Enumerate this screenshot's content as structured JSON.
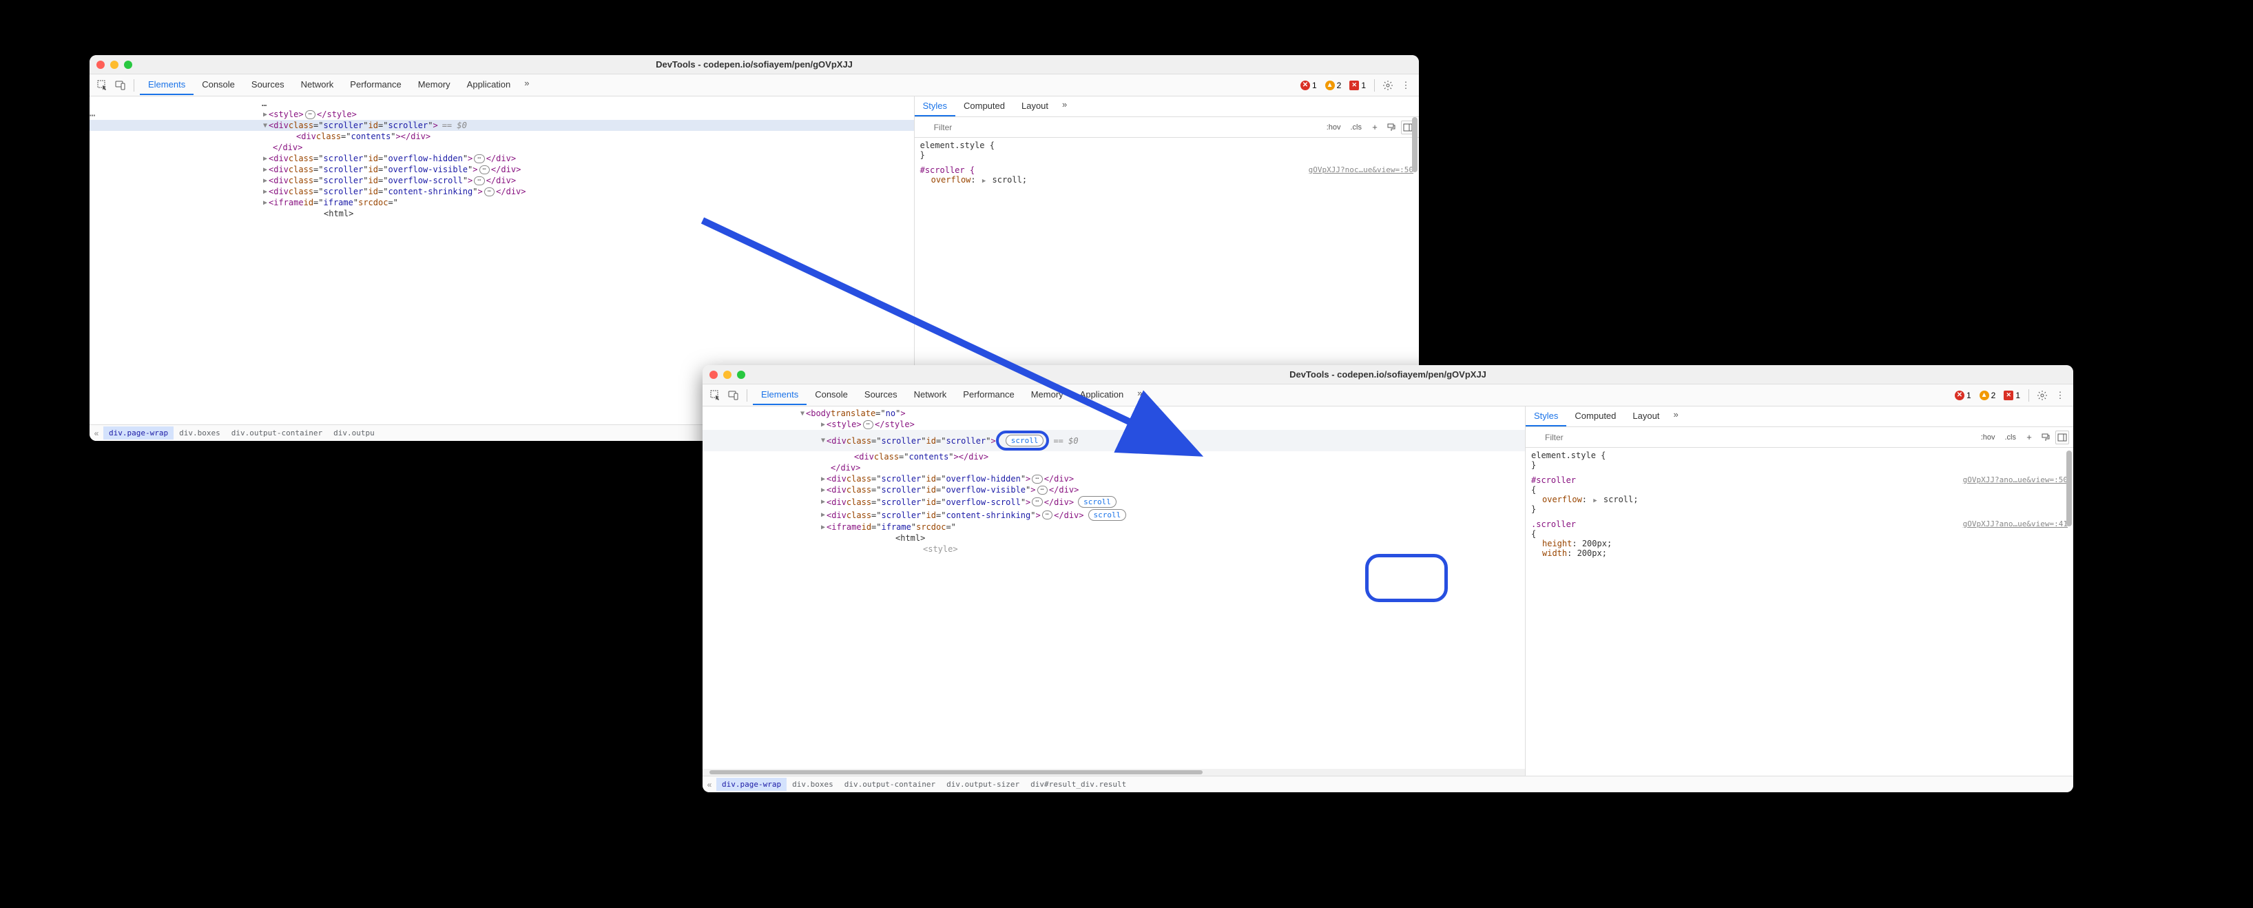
{
  "window1": {
    "title": "DevTools - codepen.io/sofiayem/pen/gOVpXJJ",
    "tabs": [
      "Elements",
      "Console",
      "Sources",
      "Network",
      "Performance",
      "Memory",
      "Application"
    ],
    "activeTab": "Elements",
    "issues": {
      "errors": "1",
      "warnings": "2",
      "info": "1"
    },
    "dom": {
      "line_body_truncated": "…",
      "style_open": "<style>",
      "style_close": "</style>",
      "scroller_open_tag": "div",
      "scroller_class": "scroller",
      "scroller_id": "scroller",
      "sel_marker": "== $0",
      "contents_tag": "div",
      "contents_class": "contents",
      "close_div": "</div>",
      "rows": [
        {
          "id": "overflow-hidden"
        },
        {
          "id": "overflow-visible"
        },
        {
          "id": "overflow-scroll"
        },
        {
          "id": "content-shrinking"
        }
      ],
      "iframe_tag": "iframe",
      "iframe_id": "iframe",
      "iframe_srcdoc": "srcdoc",
      "html_inner": "<html>"
    },
    "side": {
      "tabs": [
        "Styles",
        "Computed",
        "Layout"
      ],
      "activeTab": "Styles",
      "filter_placeholder": "Filter",
      "hov": ":hov",
      "cls": ".cls",
      "rules": {
        "element_style": "element.style {",
        "close_brace": "}",
        "scroller_sel": "#scroller {",
        "scroller_src": "gOVpXJJ?noc…ue&view=:50",
        "overflow_prop": "overflow",
        "overflow_val": "scroll"
      }
    },
    "breadcrumbs": [
      "div.page-wrap",
      "div.boxes",
      "div.output-container",
      "div.outpu"
    ]
  },
  "window2": {
    "title": "DevTools - codepen.io/sofiayem/pen/gOVpXJJ",
    "tabs": [
      "Elements",
      "Console",
      "Sources",
      "Network",
      "Performance",
      "Memory",
      "Application"
    ],
    "activeTab": "Elements",
    "issues": {
      "errors": "1",
      "warnings": "2",
      "info": "1"
    },
    "dom": {
      "body_translate": "no",
      "style_open": "<style>",
      "style_close": "</style>",
      "scroller_tag": "div",
      "scroller_class": "scroller",
      "scroller_id": "scroller",
      "scroll_badge": "scroll",
      "sel_marker": "== $0",
      "contents_tag": "div",
      "contents_class": "contents",
      "close_div": "</div>",
      "rows": [
        {
          "id": "overflow-hidden",
          "badge": null
        },
        {
          "id": "overflow-visible",
          "badge": null
        },
        {
          "id": "overflow-scroll",
          "badge": "scroll"
        },
        {
          "id": "content-shrinking",
          "badge": "scroll"
        }
      ],
      "iframe_tag": "iframe",
      "iframe_id": "iframe",
      "iframe_srcdoc": "srcdoc",
      "html_inner": "<html>",
      "style_inner": "<style>"
    },
    "side": {
      "tabs": [
        "Styles",
        "Computed",
        "Layout"
      ],
      "activeTab": "Styles",
      "filter_placeholder": "Filter",
      "hov": ":hov",
      "cls": ".cls",
      "rules": {
        "element_style": "element.style {",
        "close_brace": "}",
        "scroller_sel": "#scroller",
        "scroller_src": "gOVpXJJ?ano…ue&view=:50",
        "open_brace": "{",
        "overflow_prop": "overflow",
        "overflow_val": "scroll",
        "scroller_class_sel": ".scroller",
        "scroller_class_src": "gOVpXJJ?ano…ue&view=:41",
        "height_prop": "height",
        "height_val": "200px",
        "width_prop": "width",
        "width_val": "200px"
      }
    },
    "breadcrumbs": [
      "div.page-wrap",
      "div.boxes",
      "div.output-container",
      "div.output-sizer",
      "div#result_div.result"
    ]
  }
}
